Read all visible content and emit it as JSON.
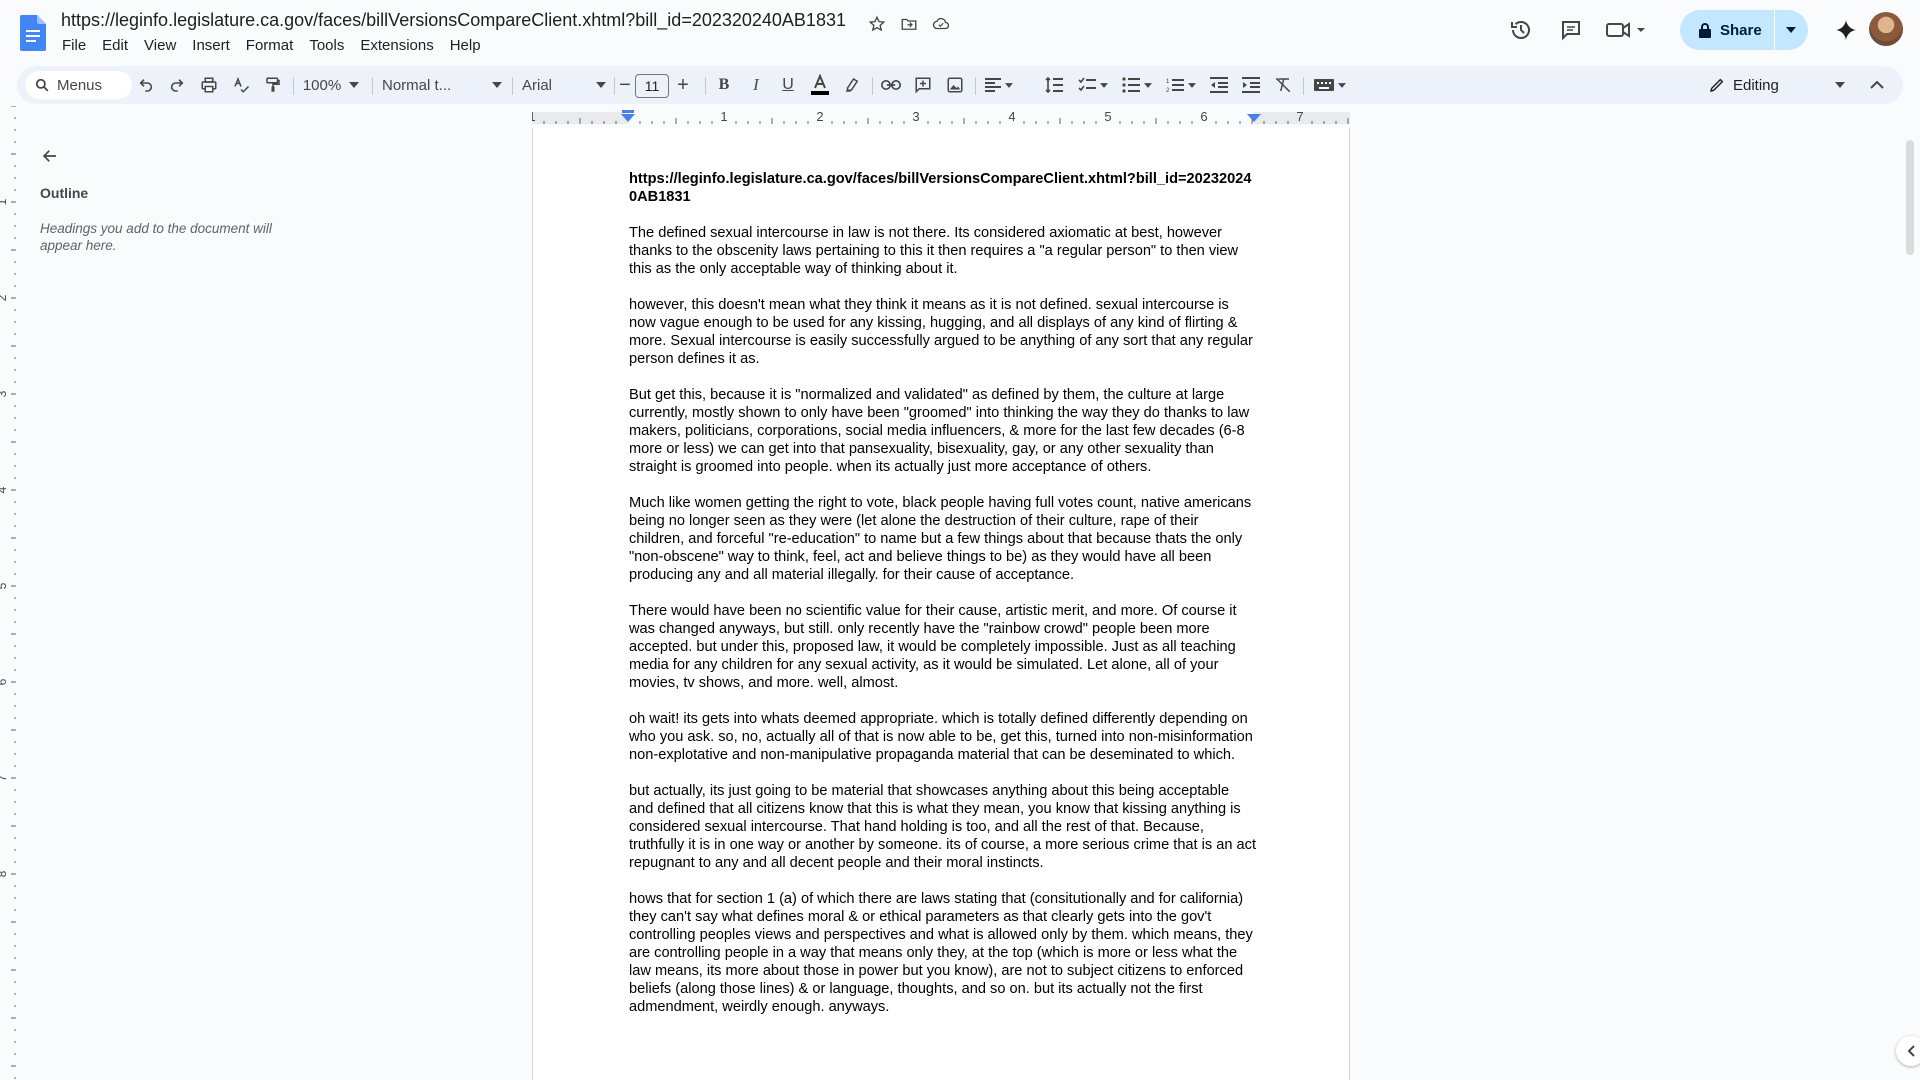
{
  "window": {
    "doc_title": "https://leginfo.legislature.ca.gov/faces/billVersionsCompareClient.xhtml?bill_id=202320240AB1831"
  },
  "menubar": [
    "File",
    "Edit",
    "View",
    "Insert",
    "Format",
    "Tools",
    "Extensions",
    "Help"
  ],
  "top_right": {
    "share_label": "Share"
  },
  "toolbar": {
    "menus_label": "Menus",
    "zoom": "100%",
    "style": "Normal t...",
    "font": "Arial",
    "font_size": "11",
    "mode": "Editing"
  },
  "outline": {
    "title": "Outline",
    "hint": "Headings you add to the document will appear here."
  },
  "ruler": {
    "h_labels": [
      "1",
      "1",
      "2",
      "3",
      "4",
      "5",
      "6",
      "7"
    ],
    "v_labels": [
      "1",
      "2",
      "3",
      "4",
      "5",
      "6",
      "7",
      "8"
    ]
  },
  "document": {
    "url_line": "https://leginfo.legislature.ca.gov/faces/billVersionsCompareClient.xhtml?bill_id=202320240AB1831",
    "paragraphs": [
      "The defined sexual intercourse in law is not there. Its considered axiomatic at best, however thanks to the obscenity laws pertaining to this it then requires a \"a regular person\" to then view this as the only acceptable way of thinking about it.",
      "however, this doesn't mean what they think it means as it is not defined. sexual intercourse is now vague enough to be used for any kissing, hugging, and all displays of any kind of flirting & more. Sexual intercourse is easily successfully argued to be anything of any sort that any regular person defines it as.",
      "But get this, because it is \"normalized and validated\" as defined by them, the culture at large currently, mostly shown to only have been \"groomed\" into thinking the way they do thanks to law makers, politicians, corporations, social media influencers, & more for the last few decades (6-8 more or less) we can get into that pansexuality, bisexuality, gay, or any other sexuality than straight is groomed into people. when its actually just more acceptance of others.",
      "Much like women getting the right to vote, black people having full votes count, native americans being no longer seen as they were (let alone the destruction of their culture, rape of their children, and forceful \"re-education\" to name but a few things about that because thats the only \"non-obscene\" way to think, feel, act and believe things to be) as they would have all been producing any and all material illegally. for their cause of acceptance.",
      "There would have been no scientific value for their cause, artistic merit, and more. Of course it was changed anyways, but still. only recently have the \"rainbow crowd\" people been more accepted. but under this, proposed law, it would be completely impossible. Just as all teaching media for any children for any sexual activity, as it would be simulated. Let alone, all of your movies, tv shows, and more. well, almost.",
      "oh wait! its gets into whats deemed appropriate. which is totally defined differently depending on who you ask. so, no, actually all of that is now able to be, get this, turned into non-misinformation non-explotative and non-manipulative propaganda material that can be deseminated to which.",
      "but actually, its just going to be material that showcases anything about this being acceptable and defined that all citizens know that this is what they mean, you know that kissing anything is considered sexual intercourse. That hand holding is too, and all the rest of that. Because, truthfully it is in one way or another by someone. its of course, a more serious crime that is an act repugnant to any and all decent people and their moral instincts.",
      "hows that for section 1 (a) of which there are laws stating that (consitutionally and for california) they can't say what defines moral & or ethical parameters as that clearly gets into the gov't controlling peoples views and perspectives and what is allowed only by them. which means, they are controlling people in a way that means only they, at the top (which is more or less what the law means, its more about those in power but you know), are not to subject citizens to enforced beliefs (along those lines) & or language, thoughts, and so on. but its actually not the first admendment, weirdly enough. anyways."
    ]
  },
  "colors": {
    "share_bg": "#c2e7ff",
    "toolbar_bg": "#edf2fa",
    "docs_blue": "#4285f4"
  }
}
